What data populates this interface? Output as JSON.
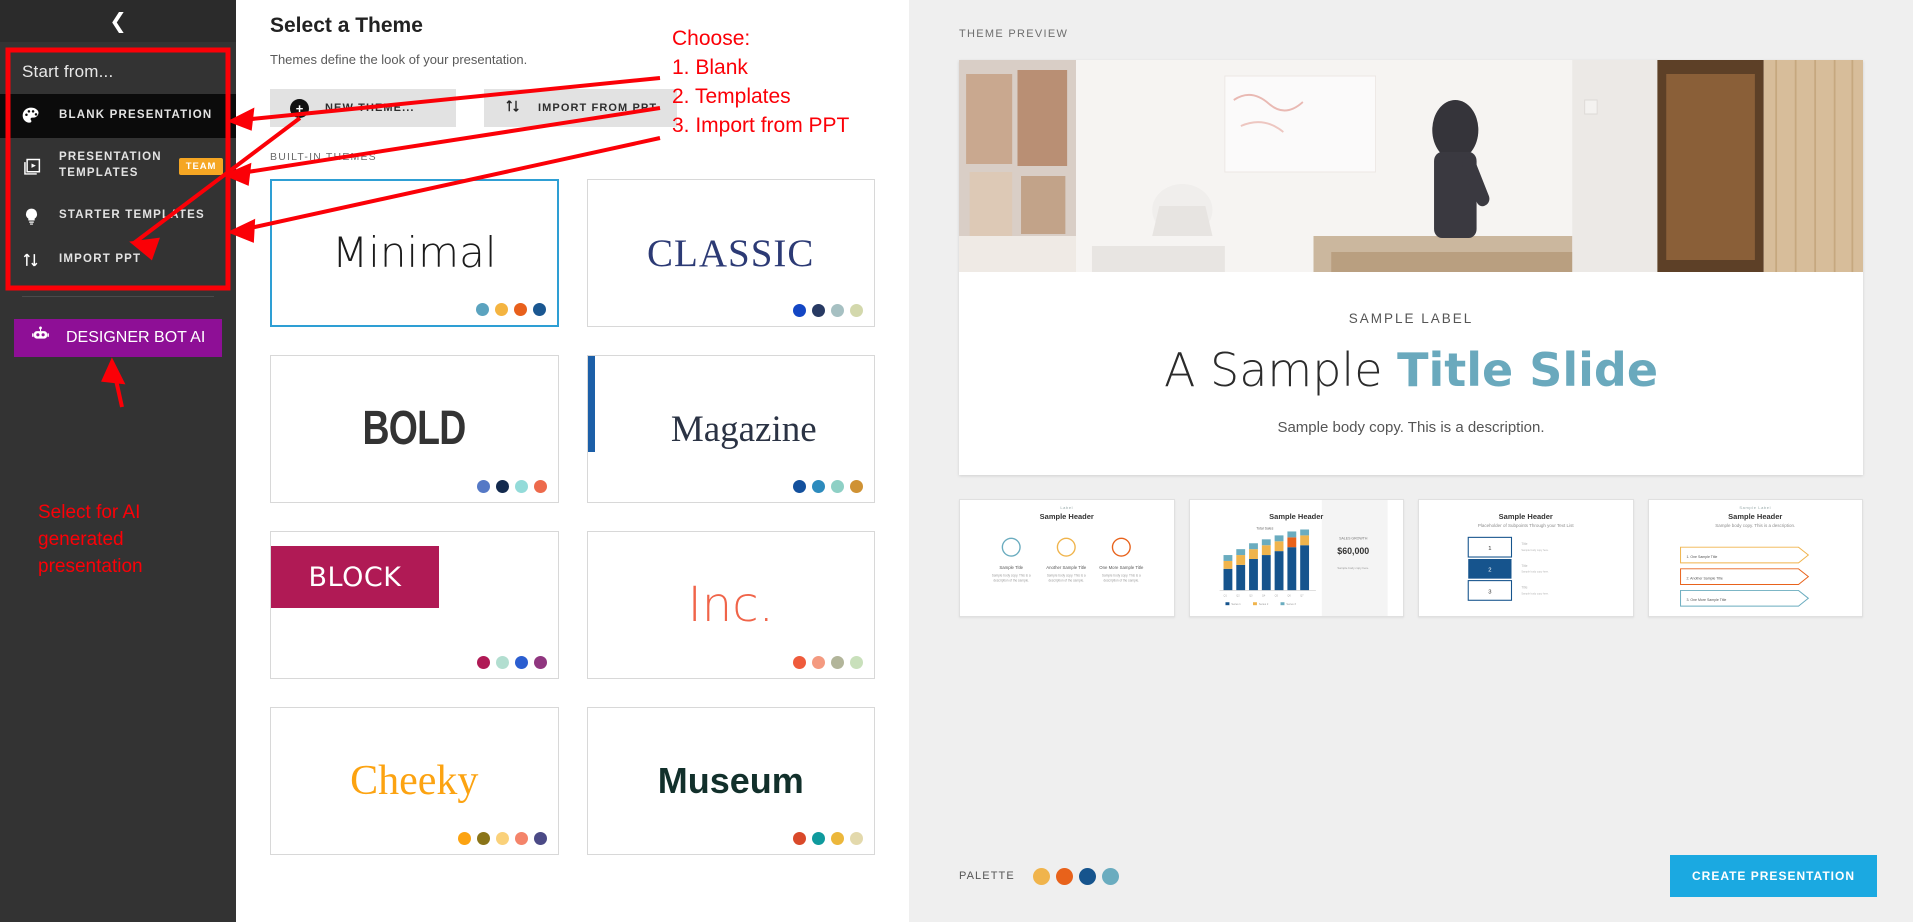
{
  "sidebar": {
    "back_icon": "chevron-left-icon",
    "heading": "Start from...",
    "items": [
      {
        "label": "BLANK PRESENTATION",
        "icon": "palette-icon",
        "badge": "",
        "active": true
      },
      {
        "label": "PRESENTATION TEMPLATES",
        "icon": "slides-play-icon",
        "badge": "TEAM",
        "active": false
      },
      {
        "label": "STARTER TEMPLATES",
        "icon": "lightbulb-icon",
        "badge": "",
        "active": false
      },
      {
        "label": "IMPORT PPT",
        "icon": "import-arrows-icon",
        "badge": "",
        "active": false
      }
    ],
    "bot_button": {
      "label": "DESIGNER BOT AI",
      "icon": "robot-icon",
      "color": "#8e0f96"
    }
  },
  "annotations": {
    "color": "#fb0007",
    "choose": "Choose:\n1. Blank\n2. Templates\n3. Import from PPT",
    "ai_note": "Select for AI\ngenerated\npresentation"
  },
  "themes_panel": {
    "title": "Select a Theme",
    "subtitle": "Themes define the look of your presentation.",
    "buttons": [
      {
        "label": "NEW THEME...",
        "icon": "plus-circle-icon"
      },
      {
        "label": "IMPORT FROM PPT",
        "icon": "import-arrows-icon"
      }
    ],
    "section_label": "BUILT-IN THEMES",
    "themes": [
      {
        "name": "Minimal",
        "selected": true,
        "style": "minimal",
        "dots": [
          "#5ba3bf",
          "#f4b441",
          "#e8601c",
          "#1a5791"
        ]
      },
      {
        "name": "CLASSIC",
        "selected": false,
        "style": "classic",
        "dots": [
          "#1346c4",
          "#283a63",
          "#a6c0c2",
          "#d3d8ac"
        ]
      },
      {
        "name": "BOLD",
        "selected": false,
        "style": "bold",
        "dots": [
          "#5579c6",
          "#132a4e",
          "#93dbd9",
          "#ed6a4c"
        ]
      },
      {
        "name": "Magazine",
        "selected": false,
        "style": "magazine",
        "dots": [
          "#13509d",
          "#2d8bbd",
          "#8ed0c5",
          "#cf9234"
        ]
      },
      {
        "name": "BLOCK",
        "selected": false,
        "style": "block",
        "dots": [
          "#b01a55",
          "#b2ded0",
          "#2b5ed0",
          "#90367f"
        ]
      },
      {
        "name": "Inc.",
        "selected": false,
        "style": "inc",
        "dots": [
          "#ef5b3c",
          "#f49a80",
          "#b2b59a",
          "#c9e0bb"
        ]
      },
      {
        "name": "Cheeky",
        "selected": false,
        "style": "cheeky",
        "dots": [
          "#fca311",
          "#8a7418",
          "#fad17a",
          "#f4846a",
          "#4b4a86"
        ]
      },
      {
        "name": "Museum",
        "selected": false,
        "style": "museum",
        "dots": [
          "#d9492a",
          "#0f9a9d",
          "#ecb73b",
          "#e3d9ac"
        ]
      }
    ]
  },
  "preview": {
    "label": "THEME PREVIEW",
    "slide": {
      "eyebrow": "SAMPLE LABEL",
      "title_plain": "A Sample ",
      "title_accent": "Title Slide",
      "body": "Sample body copy. This is a description."
    },
    "thumbnails": [
      {
        "label": "Label",
        "header": "Sample Header",
        "sub": "Sample body copy. This is a description.",
        "kind": "icons"
      },
      {
        "label": "",
        "header": "Sample Header",
        "sub": "Total Sales",
        "kind": "chart",
        "stat": "$60,000",
        "stat_label": "SALES GROWTH"
      },
      {
        "label": "",
        "header": "Sample Header",
        "sub": "Placeholder of Subpoints Through your Text List",
        "kind": "steps",
        "steps": [
          "1",
          "2",
          "3"
        ]
      },
      {
        "label": "Sample Label",
        "header": "Sample Header",
        "sub": "Sample body copy. This is a description.",
        "kind": "arrows",
        "rows": [
          "1. One Sample Title",
          "2. Another Sample Title",
          "3. One More Sample Title"
        ]
      }
    ],
    "palette_label": "PALETTE",
    "palette": [
      "#f0b44c",
      "#e8621b",
      "#16548d",
      "#6aacbf"
    ],
    "create_button": {
      "label": "CREATE PRESENTATION",
      "color": "#1ba9e1"
    }
  }
}
